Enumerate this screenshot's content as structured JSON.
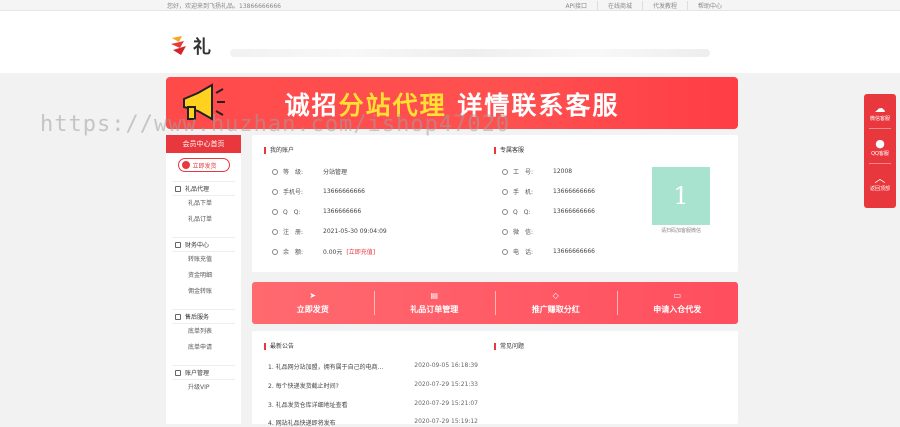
{
  "topbar": {
    "welcome": "您好，欢迎来到飞扬礼品。13866666666",
    "links": [
      "API接口",
      "在线商城",
      "代发教程",
      "帮助中心"
    ]
  },
  "header": {
    "logo_text": "礼"
  },
  "banner": {
    "title_pre": "诚招",
    "title_hl": "分站代理",
    "title_post": " 详情联系客服"
  },
  "watermark": "https://www.huzhan.com/ishop47020",
  "sidebar": {
    "center_title": "会员中心首页",
    "ship_label": "立即发货",
    "groups": [
      {
        "title": "礼品代理",
        "items": [
          "礼品下单",
          "礼品订单"
        ]
      },
      {
        "title": "财务中心",
        "items": [
          "转账充值",
          "资金明细",
          "佣金转账"
        ]
      },
      {
        "title": "售后服务",
        "items": [
          "底单列表",
          "底单申请"
        ]
      },
      {
        "title": "账户管理",
        "items": [
          "升级VIP"
        ]
      }
    ]
  },
  "account": {
    "title": "我的账户",
    "rows": [
      {
        "label": "等　级:",
        "value": "分站管理"
      },
      {
        "label": "手机号:",
        "value": "13666666666"
      },
      {
        "label": "Q　Q:",
        "value": "1366666666"
      },
      {
        "label": "注　册:",
        "value": "2021-05-30 09:04:09"
      },
      {
        "label": "余　额:",
        "value": "0.00元",
        "extra": "[立即充值]"
      }
    ]
  },
  "service": {
    "title": "专属客服",
    "rows": [
      {
        "label": "工　号:",
        "value": "12008"
      },
      {
        "label": "手　机:",
        "value": "13666666666"
      },
      {
        "label": "Q　Q:",
        "value": "13666666666"
      },
      {
        "label": "微　信:",
        "value": ""
      },
      {
        "label": "电　话:",
        "value": "13666666666"
      }
    ],
    "qr_text": "1",
    "qr_caption": "请扫码加客服微信"
  },
  "actions": [
    {
      "label": "立即发货",
      "icon": "➤"
    },
    {
      "label": "礼品订单管理",
      "icon": "▤"
    },
    {
      "label": "推广赚取分红",
      "icon": "◇"
    },
    {
      "label": "申请入仓代发",
      "icon": "▭"
    }
  ],
  "news": {
    "title": "最新公告",
    "faq_title": "常见问题",
    "items": [
      {
        "text": "1. 礼品网分站加盟，拥有属于自己的电商...",
        "date": "2020-09-05 16:18:39"
      },
      {
        "text": "2. 每个快递发货截止时间?",
        "date": "2020-07-29 15:21:33"
      },
      {
        "text": "3. 礼品发货仓库详细地址查看",
        "date": "2020-07-29 15:21:07"
      },
      {
        "text": "4. 网站礼品快递即将发布",
        "date": "2020-07-29 15:19:12"
      }
    ]
  },
  "float": {
    "items": [
      "微信客服",
      "QQ客服",
      "返回顶部"
    ]
  },
  "colors": {
    "accent": "#e8383d",
    "highlight": "#ffe033",
    "qr": "#a8e3cf"
  }
}
